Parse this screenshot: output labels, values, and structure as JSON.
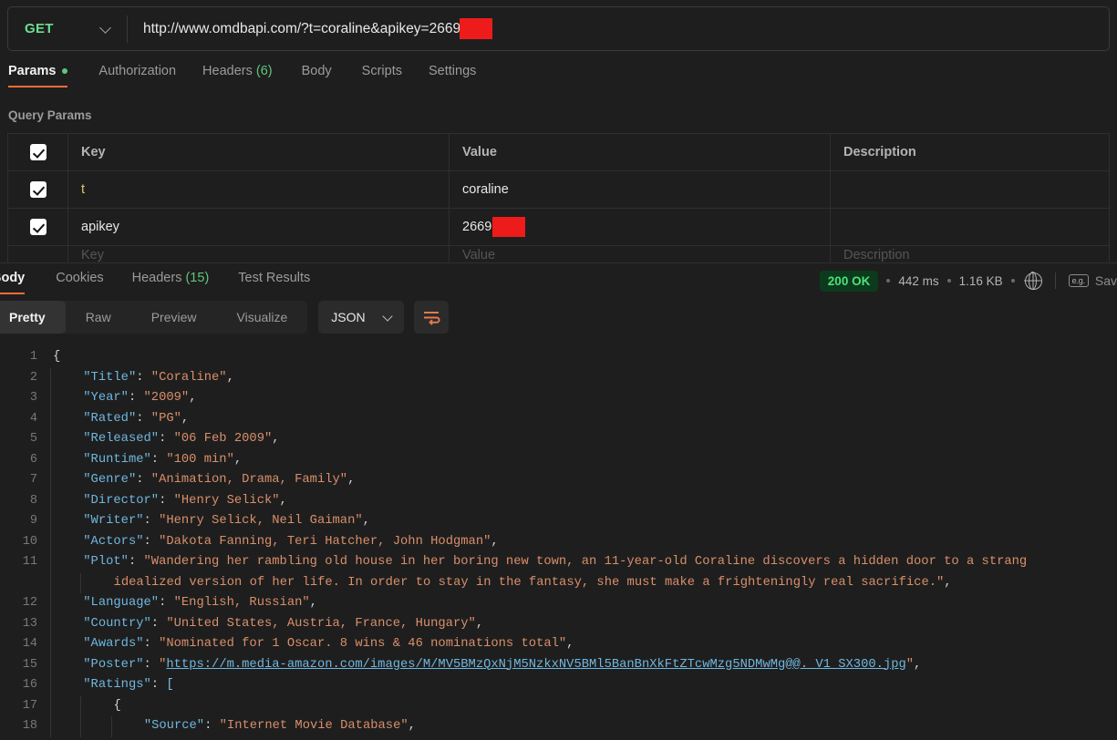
{
  "request": {
    "method": "GET",
    "method_chevron_icon": "chevron-down-icon",
    "url": "http://www.omdbapi.com/?t=coraline&apikey=2669",
    "url_redacted": true,
    "tabs": [
      {
        "label": "Params",
        "badge": "dot",
        "active": true
      },
      {
        "label": "Authorization",
        "badge": "",
        "active": false
      },
      {
        "label": "Headers",
        "badge": "(6)",
        "active": false
      },
      {
        "label": "Body",
        "badge": "",
        "active": false
      },
      {
        "label": "Scripts",
        "badge": "",
        "active": false
      },
      {
        "label": "Settings",
        "badge": "",
        "active": false
      }
    ]
  },
  "query_params": {
    "section_title": "Query Params",
    "columns": [
      "Key",
      "Value",
      "Description"
    ],
    "rows": [
      {
        "checked": true,
        "key": "t",
        "value": "coraline",
        "description": "",
        "redacted": false
      },
      {
        "checked": true,
        "key": "apikey",
        "value": "2669",
        "description": "",
        "redacted": true
      }
    ],
    "ghost_row": {
      "key": "Key",
      "value": "Value",
      "description": "Description"
    }
  },
  "response": {
    "tabs": [
      {
        "label": "Body",
        "badge": "",
        "active": true
      },
      {
        "label": "Cookies",
        "badge": "",
        "active": false
      },
      {
        "label": "Headers",
        "badge": "(15)",
        "active": false
      },
      {
        "label": "Test Results",
        "badge": "",
        "active": false
      }
    ],
    "status": "200 OK",
    "time": "442 ms",
    "size": "1.16 KB",
    "globe_icon": "globe-icon",
    "eg_icon": "e.g.",
    "save_label": "Sav",
    "view_modes": [
      {
        "label": "Pretty",
        "active": true
      },
      {
        "label": "Raw",
        "active": false
      },
      {
        "label": "Preview",
        "active": false
      },
      {
        "label": "Visualize",
        "active": false
      }
    ],
    "format": "JSON",
    "format_chevron_icon": "chevron-down-icon",
    "wrap_icon": "word-wrap-icon"
  },
  "body_json": {
    "lines": [
      {
        "n": "1",
        "indent": 0,
        "segs": [
          [
            "p",
            "{"
          ]
        ]
      },
      {
        "n": "2",
        "indent": 1,
        "segs": [
          [
            "k",
            "\"Title\""
          ],
          [
            "p",
            ": "
          ],
          [
            "s",
            "\"Coraline\""
          ],
          [
            "p",
            ","
          ]
        ]
      },
      {
        "n": "3",
        "indent": 1,
        "segs": [
          [
            "k",
            "\"Year\""
          ],
          [
            "p",
            ": "
          ],
          [
            "s",
            "\"2009\""
          ],
          [
            "p",
            ","
          ]
        ]
      },
      {
        "n": "4",
        "indent": 1,
        "segs": [
          [
            "k",
            "\"Rated\""
          ],
          [
            "p",
            ": "
          ],
          [
            "s",
            "\"PG\""
          ],
          [
            "p",
            ","
          ]
        ]
      },
      {
        "n": "5",
        "indent": 1,
        "segs": [
          [
            "k",
            "\"Released\""
          ],
          [
            "p",
            ": "
          ],
          [
            "s",
            "\"06 Feb 2009\""
          ],
          [
            "p",
            ","
          ]
        ]
      },
      {
        "n": "6",
        "indent": 1,
        "segs": [
          [
            "k",
            "\"Runtime\""
          ],
          [
            "p",
            ": "
          ],
          [
            "s",
            "\"100 min\""
          ],
          [
            "p",
            ","
          ]
        ]
      },
      {
        "n": "7",
        "indent": 1,
        "segs": [
          [
            "k",
            "\"Genre\""
          ],
          [
            "p",
            ": "
          ],
          [
            "s",
            "\"Animation, Drama, Family\""
          ],
          [
            "p",
            ","
          ]
        ]
      },
      {
        "n": "8",
        "indent": 1,
        "segs": [
          [
            "k",
            "\"Director\""
          ],
          [
            "p",
            ": "
          ],
          [
            "s",
            "\"Henry Selick\""
          ],
          [
            "p",
            ","
          ]
        ]
      },
      {
        "n": "9",
        "indent": 1,
        "segs": [
          [
            "k",
            "\"Writer\""
          ],
          [
            "p",
            ": "
          ],
          [
            "s",
            "\"Henry Selick, Neil Gaiman\""
          ],
          [
            "p",
            ","
          ]
        ]
      },
      {
        "n": "10",
        "indent": 1,
        "segs": [
          [
            "k",
            "\"Actors\""
          ],
          [
            "p",
            ": "
          ],
          [
            "s",
            "\"Dakota Fanning, Teri Hatcher, John Hodgman\""
          ],
          [
            "p",
            ","
          ]
        ]
      },
      {
        "n": "11",
        "indent": 1,
        "segs": [
          [
            "k",
            "\"Plot\""
          ],
          [
            "p",
            ": "
          ],
          [
            "s",
            "\"Wandering her rambling old house in her boring new town, an 11-year-old Coraline discovers a hidden door to a strang"
          ]
        ]
      },
      {
        "n": "",
        "indent": 2,
        "segs": [
          [
            "s",
            "idealized version of her life. In order to stay in the fantasy, she must make a frighteningly real sacrifice.\""
          ],
          [
            "p",
            ","
          ]
        ]
      },
      {
        "n": "12",
        "indent": 1,
        "segs": [
          [
            "k",
            "\"Language\""
          ],
          [
            "p",
            ": "
          ],
          [
            "s",
            "\"English, Russian\""
          ],
          [
            "p",
            ","
          ]
        ]
      },
      {
        "n": "13",
        "indent": 1,
        "segs": [
          [
            "k",
            "\"Country\""
          ],
          [
            "p",
            ": "
          ],
          [
            "s",
            "\"United States, Austria, France, Hungary\""
          ],
          [
            "p",
            ","
          ]
        ]
      },
      {
        "n": "14",
        "indent": 1,
        "segs": [
          [
            "k",
            "\"Awards\""
          ],
          [
            "p",
            ": "
          ],
          [
            "s",
            "\"Nominated for 1 Oscar. 8 wins & 46 nominations total\""
          ],
          [
            "p",
            ","
          ]
        ]
      },
      {
        "n": "15",
        "indent": 1,
        "segs": [
          [
            "k",
            "\"Poster\""
          ],
          [
            "p",
            ": "
          ],
          [
            "s",
            "\""
          ],
          [
            "lnk",
            "https://m.media-amazon.com/images/M/MV5BMzQxNjM5NzkxNV5BMl5BanBnXkFtZTcwMzg5NDMwMg@@._V1_SX300.jpg"
          ],
          [
            "s",
            "\""
          ],
          [
            "p",
            ","
          ]
        ]
      },
      {
        "n": "16",
        "indent": 1,
        "segs": [
          [
            "k",
            "\"Ratings\""
          ],
          [
            "p",
            ": "
          ],
          [
            "brk",
            "["
          ]
        ]
      },
      {
        "n": "17",
        "indent": 2,
        "segs": [
          [
            "p",
            "{"
          ]
        ]
      },
      {
        "n": "18",
        "indent": 3,
        "segs": [
          [
            "k",
            "\"Source\""
          ],
          [
            "p",
            ": "
          ],
          [
            "s",
            "\"Internet Movie Database\""
          ],
          [
            "p",
            ","
          ]
        ]
      }
    ]
  }
}
